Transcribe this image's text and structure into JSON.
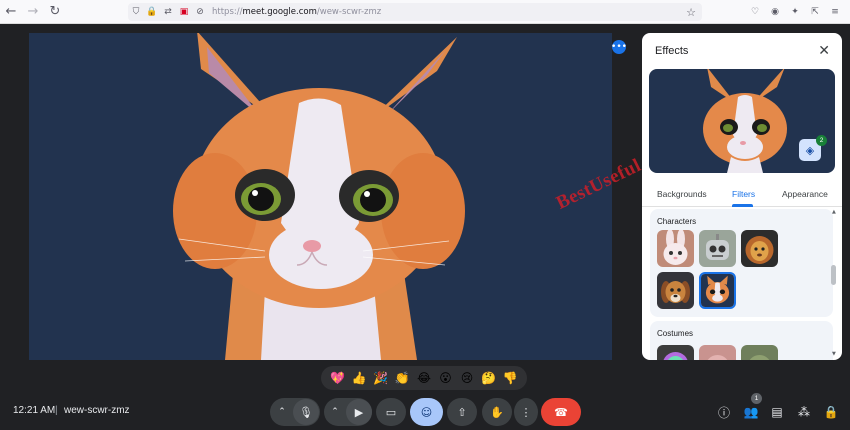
{
  "browser": {
    "url_prefix": "https://",
    "url_domain": "meet.google.com",
    "url_path": "/wew-scwr-zmz",
    "back_icon": "arrow-left-icon",
    "forward_icon": "arrow-right-icon",
    "reload_icon": "reload-icon"
  },
  "panel": {
    "title": "Effects",
    "layers_count": "2",
    "tabs": [
      "Backgrounds",
      "Filters",
      "Appearance"
    ],
    "active_tab": "Filters",
    "sections": {
      "characters": "Characters",
      "costumes": "Costumes"
    }
  },
  "watermark": "BestUseful",
  "reactions": [
    "💖",
    "👍",
    "🎉",
    "👏",
    "😂",
    "😮",
    "😢",
    "🤔",
    "👎"
  ],
  "meeting": {
    "time": "12:21 AM",
    "separator": "|",
    "code": "wew-scwr-zmz",
    "people_count": "1"
  },
  "colors": {
    "video_bg": "#22334f",
    "accent": "#1a73e8",
    "end_call": "#ea4335",
    "active_control": "#a8c7fa",
    "watermark": "#cd1e28"
  }
}
